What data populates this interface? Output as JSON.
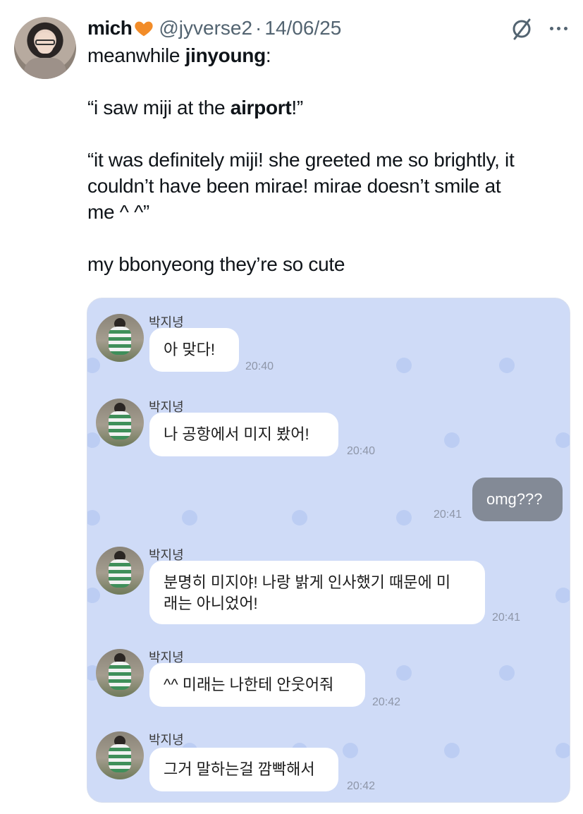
{
  "tweet": {
    "display_name": "mich",
    "handle": "@jyverse2",
    "separator": "·",
    "date": "14/06/25",
    "lines": [
      [
        {
          "t": "meanwhile "
        },
        {
          "t": "jinyoung",
          "b": true
        },
        {
          "t": ":"
        }
      ],
      [],
      [
        {
          "t": "“i saw miji at the "
        },
        {
          "t": "airport",
          "b": true
        },
        {
          "t": "!”"
        }
      ],
      [],
      [
        {
          "t": "“it was definitely miji! she greeted me so brightly, it"
        }
      ],
      [
        {
          "t": "couldn’t have been mirae! mirae doesn’t smile at"
        }
      ],
      [
        {
          "t": "me ^ ^”"
        }
      ],
      [],
      [
        {
          "t": "my bbonyeong they’re so cute"
        }
      ]
    ]
  },
  "chat": {
    "sender_name": "박지녕",
    "messages": [
      {
        "text": "아 맞다!",
        "time": "20:40"
      },
      {
        "text": "나 공항에서 미지 봤어!",
        "time": "20:40"
      },
      {
        "text": "omg???",
        "time": "20:41",
        "mine": true
      },
      {
        "text": "분명히 미지야! 나랑 밝게 인사했기 때문에 미",
        "text2": "래는 아니었어!",
        "time": "20:41"
      },
      {
        "text": "^^ 미래는 나한테 안웃어줘",
        "time": "20:42"
      },
      {
        "text": "그거 말하는걸 깜빡해서",
        "time": "20:42"
      }
    ]
  },
  "colors": {
    "chat_background": "#cfdbf7",
    "bubble_incoming": "#ffffff",
    "bubble_outgoing": "#838a96",
    "heart": "#f28c28",
    "secondary_text": "#536471"
  },
  "icons": {
    "heart": "orange-heart-icon",
    "grok": "slashed-circle-icon",
    "more": "more-horizontal-icon"
  }
}
